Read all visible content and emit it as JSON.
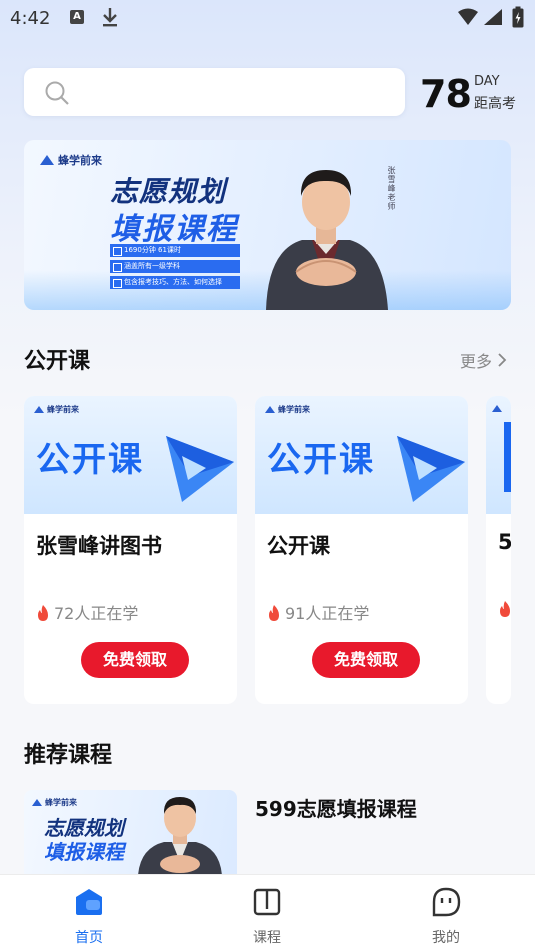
{
  "status_bar": {
    "time": "4:42",
    "notification_badge": "A"
  },
  "search": {
    "placeholder": ""
  },
  "countdown": {
    "number": "78",
    "unit": "DAY",
    "label": "距高考"
  },
  "banner": {
    "logo_text": "蜂学前来",
    "title_line1": "志愿规划",
    "title_line2": "填报课程",
    "bullets": [
      "1690分钟  61课时",
      "涵盖所有一级学科",
      "包含报考技巧、方法、如何选择"
    ],
    "side_text": "张雪峰老师"
  },
  "open_courses": {
    "section_title": "公开课",
    "more_label": "更多",
    "items": [
      {
        "cover_logo": "蜂学前来",
        "cover_title": "公开课",
        "name": "张雪峰讲图书",
        "learners": "72人正在学",
        "button": "免费领取"
      },
      {
        "cover_logo": "蜂学前来",
        "cover_title": "公开课",
        "name": "公开课",
        "learners": "91人正在学",
        "button": "免费领取"
      },
      {
        "cover_logo": "",
        "cover_title": "",
        "name": "5",
        "learners": "",
        "button": ""
      }
    ]
  },
  "recommended": {
    "section_title": "推荐课程",
    "items": [
      {
        "cover_logo": "蜂学前来",
        "cover_line1": "志愿规划",
        "cover_line2": "填报课程",
        "title": "599志愿填报课程"
      }
    ]
  },
  "tab_bar": {
    "items": [
      {
        "label": "首页",
        "icon": "home-icon",
        "active": true
      },
      {
        "label": "课程",
        "icon": "book-icon",
        "active": false
      },
      {
        "label": "我的",
        "icon": "profile-icon",
        "active": false
      }
    ]
  },
  "colors": {
    "accent_blue": "#1a6ff0",
    "button_red": "#e8192c",
    "fire_red": "#f04a3a"
  }
}
